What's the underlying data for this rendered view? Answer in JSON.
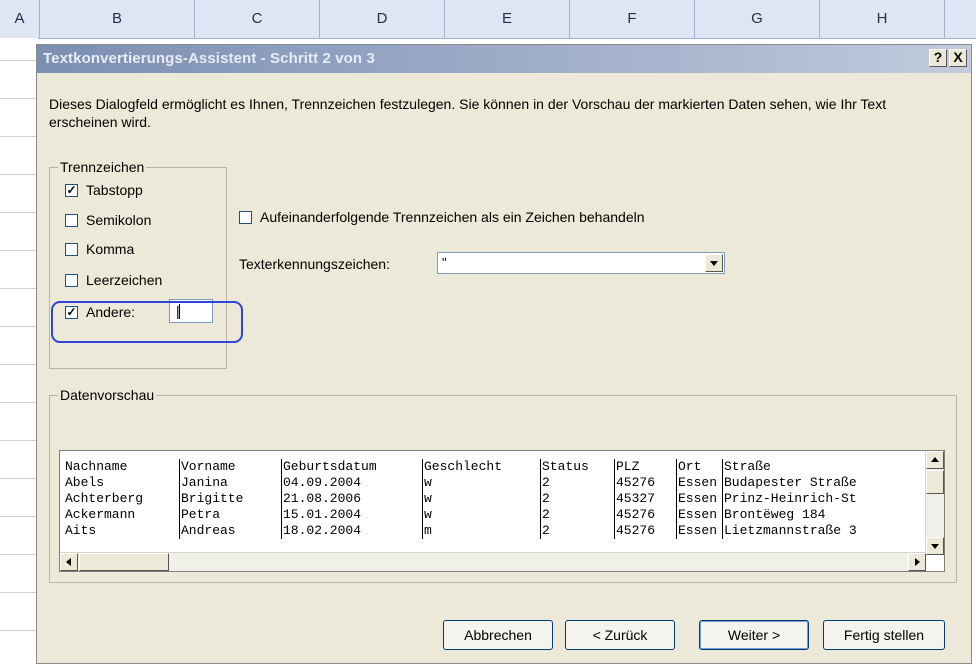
{
  "sheet": {
    "columns": [
      "A",
      "B",
      "C",
      "D",
      "E",
      "F",
      "G",
      "H"
    ]
  },
  "dialog": {
    "title": "Textkonvertierungs-Assistent - Schritt 2 von 3",
    "help_label": "?",
    "close_label": "X",
    "description": "Dieses Dialogfeld ermöglicht es Ihnen, Trennzeichen festzulegen. Sie können in der Vorschau der markierten Daten sehen, wie Ihr Text erscheinen wird."
  },
  "delimiters": {
    "legend": "Trennzeichen",
    "tab": {
      "label": "Tabstopp",
      "checked": true
    },
    "semicolon": {
      "label": "Semikolon",
      "checked": false
    },
    "comma": {
      "label": "Komma",
      "checked": false
    },
    "space": {
      "label": "Leerzeichen",
      "checked": false
    },
    "other": {
      "label": "Andere:",
      "checked": true,
      "value": "|"
    }
  },
  "options": {
    "consecutive_label": "Aufeinanderfolgende Trennzeichen als ein Zeichen behandeln",
    "consecutive_checked": false,
    "text_qualifier_label": "Texterkennungszeichen:",
    "text_qualifier_value": "\""
  },
  "preview": {
    "legend": "Datenvorschau",
    "headers": [
      "Nachname",
      "Vorname",
      "Geburtsdatum",
      "Geschlecht",
      "Status",
      "PLZ",
      "Ort",
      "Straße"
    ],
    "rows": [
      [
        "Abels",
        "Janina",
        "04.09.2004",
        "w",
        "2",
        "45276",
        "Essen",
        "Budapester Straße"
      ],
      [
        "Achterberg",
        "Brigitte",
        "21.08.2006",
        "w",
        "2",
        "45327",
        "Essen",
        "Prinz-Heinrich-St"
      ],
      [
        "Ackermann",
        "Petra",
        "15.01.2004",
        "w",
        "2",
        "45276",
        "Essen",
        "Brontëweg 184"
      ],
      [
        "Aits",
        "Andreas",
        "18.02.2004",
        "m",
        "2",
        "45276",
        "Essen",
        "Lietzmannstraße 3"
      ]
    ]
  },
  "buttons": {
    "cancel": "Abbrechen",
    "back": "< Zurück",
    "next": "Weiter >",
    "finish": "Fertig stellen"
  }
}
